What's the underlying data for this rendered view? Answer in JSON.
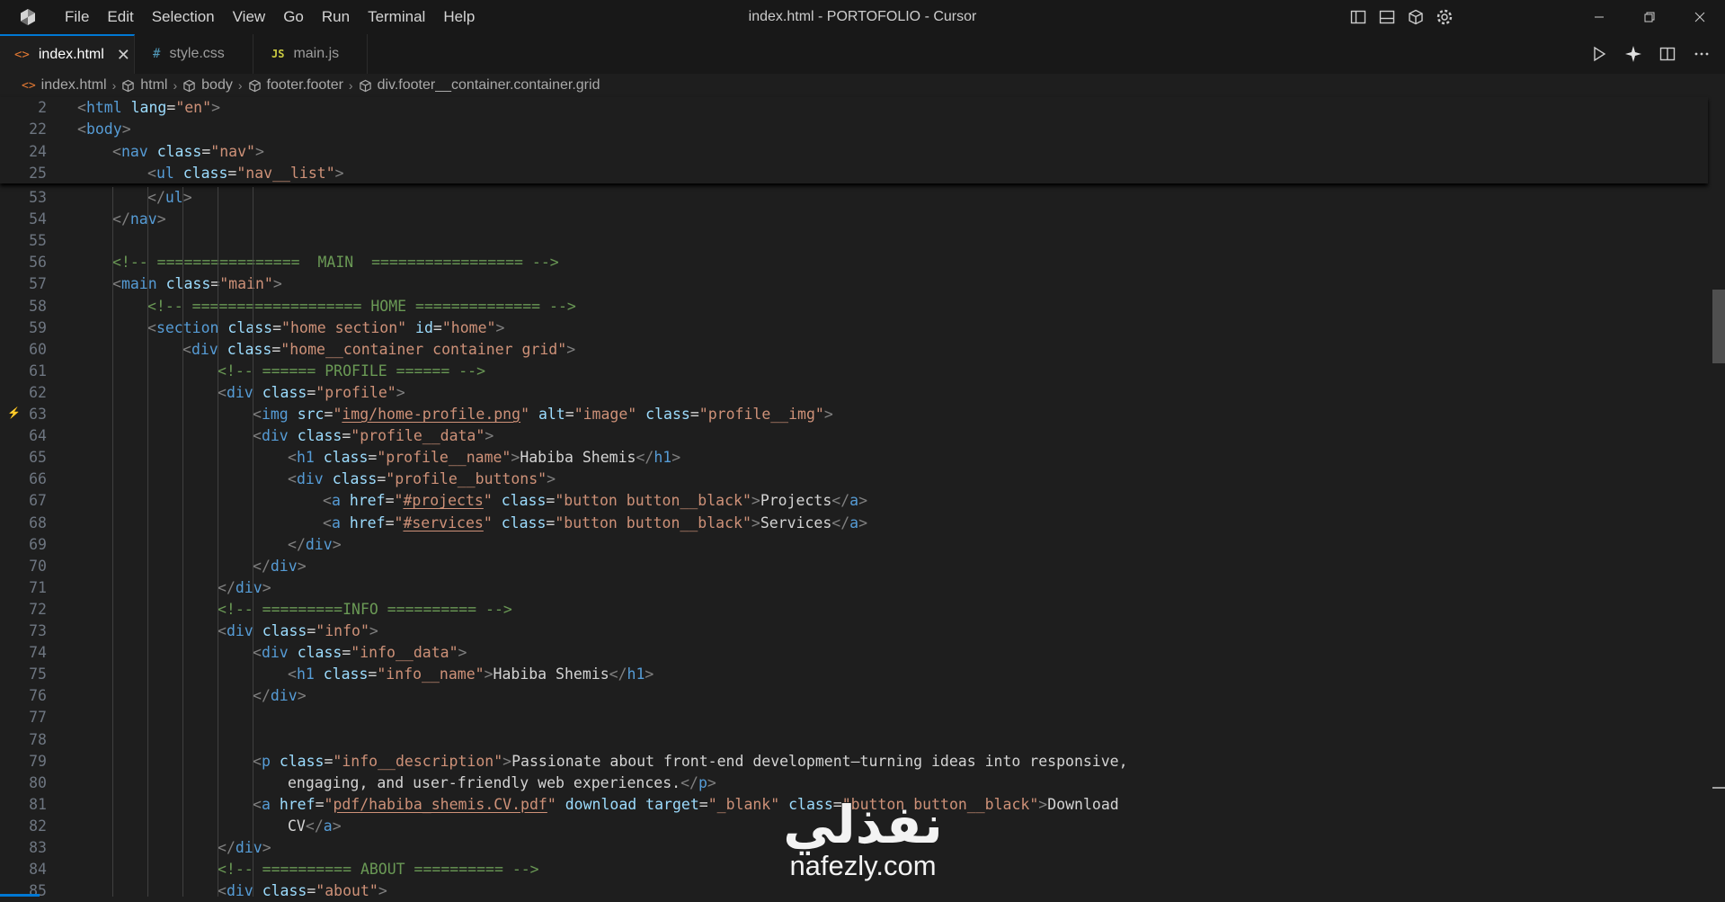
{
  "window": {
    "title": "index.html - PORTOFOLIO - Cursor",
    "menu": [
      "File",
      "Edit",
      "Selection",
      "View",
      "Go",
      "Run",
      "Terminal",
      "Help"
    ]
  },
  "tabs": [
    {
      "label": "index.html",
      "icon": "<>",
      "active": true
    },
    {
      "label": "style.css",
      "icon": "#",
      "active": false
    },
    {
      "label": "main.js",
      "icon": "JS",
      "active": false
    }
  ],
  "breadcrumb": [
    "index.html",
    "html",
    "body",
    "footer.footer",
    "div.footer__container.container.grid"
  ],
  "editor": {
    "sticky_lines": [
      {
        "n": "2",
        "indent": 0,
        "code": "<html lang=\"en\">"
      },
      {
        "n": "22",
        "indent": 0,
        "code": "<body>"
      },
      {
        "n": "24",
        "indent": 1,
        "code": "<nav class=\"nav\">"
      },
      {
        "n": "25",
        "indent": 2,
        "code": "<ul class=\"nav__list\">"
      }
    ],
    "lines": [
      {
        "n": "53",
        "indent": 2,
        "code": "</ul>"
      },
      {
        "n": "54",
        "indent": 1,
        "code": "</nav>"
      },
      {
        "n": "55",
        "indent": 0,
        "code": ""
      },
      {
        "n": "56",
        "indent": 1,
        "code": "<!-- ================  MAIN  ================= -->"
      },
      {
        "n": "57",
        "indent": 1,
        "code": "<main class=\"main\">"
      },
      {
        "n": "58",
        "indent": 2,
        "code": "<!-- =================== HOME ============== -->"
      },
      {
        "n": "59",
        "indent": 2,
        "code": "<section class=\"home section\" id=\"home\">"
      },
      {
        "n": "60",
        "indent": 3,
        "code": "<div class=\"home__container container grid\">"
      },
      {
        "n": "61",
        "indent": 4,
        "code": "<!-- ====== PROFILE ====== -->"
      },
      {
        "n": "62",
        "indent": 4,
        "code": "<div class=\"profile\">"
      },
      {
        "n": "63",
        "indent": 5,
        "code": "<img src=\"img/home-profile.png\" alt=\"image\" class=\"profile__img\">"
      },
      {
        "n": "64",
        "indent": 5,
        "code": "<div class=\"profile__data\">"
      },
      {
        "n": "65",
        "indent": 6,
        "code": "<h1 class=\"profile__name\">Habiba Shemis</h1>"
      },
      {
        "n": "66",
        "indent": 6,
        "code": "<div class=\"profile__buttons\">"
      },
      {
        "n": "67",
        "indent": 7,
        "code": "<a href=\"#projects\" class=\"button button__black\">Projects</a>"
      },
      {
        "n": "68",
        "indent": 7,
        "code": "<a href=\"#services\" class=\"button button__black\">Services</a>"
      },
      {
        "n": "69",
        "indent": 6,
        "code": "</div>"
      },
      {
        "n": "70",
        "indent": 5,
        "code": "</div>"
      },
      {
        "n": "71",
        "indent": 4,
        "code": "</div>"
      },
      {
        "n": "72",
        "indent": 4,
        "code": "<!-- =========INFO ========== -->"
      },
      {
        "n": "73",
        "indent": 4,
        "code": "<div class=\"info\">"
      },
      {
        "n": "74",
        "indent": 5,
        "code": "<div class=\"info__data\">"
      },
      {
        "n": "75",
        "indent": 6,
        "code": "<h1 class=\"info__name\">Habiba Shemis</h1>"
      },
      {
        "n": "76",
        "indent": 5,
        "code": "</div>"
      },
      {
        "n": "77",
        "indent": 0,
        "code": ""
      },
      {
        "n": "78",
        "indent": 0,
        "code": ""
      },
      {
        "n": "79",
        "indent": 5,
        "code": "<p class=\"info__description\">Passionate about front-end development—turning ideas into responsive,"
      },
      {
        "n": "80",
        "indent": 6,
        "code": "engaging, and user-friendly web experiences.</p>"
      },
      {
        "n": "81",
        "indent": 5,
        "code": "<a href=\"pdf/habiba_shemis.CV.pdf\" download target=\"_blank\" class=\"button button__black\">Download"
      },
      {
        "n": "82",
        "indent": 6,
        "code": "CV</a>"
      },
      {
        "n": "83",
        "indent": 4,
        "code": "</div>"
      },
      {
        "n": "84",
        "indent": 4,
        "code": "<!-- ========== ABOUT ========== -->"
      },
      {
        "n": "85",
        "indent": 4,
        "code": "<div class=\"about\">"
      }
    ]
  },
  "watermark": {
    "arabic": "نفذلي",
    "latin": "nafezly.com"
  },
  "colors": {
    "background": "#1e1e1e",
    "titlebar": "#181818",
    "accent": "#0078d4",
    "tag": "#569cd6",
    "attribute": "#9cdcfe",
    "string": "#ce9178",
    "comment": "#6a9955"
  },
  "icons": [
    "cursor-logo-icon",
    "toggle-primary-sidebar-icon",
    "toggle-panel-icon",
    "toggle-secondary-sidebar-icon",
    "settings-gear-icon",
    "minimize-icon",
    "restore-icon",
    "close-window-icon",
    "run-icon",
    "sparkle-icon",
    "split-editor-icon",
    "more-actions-icon"
  ]
}
